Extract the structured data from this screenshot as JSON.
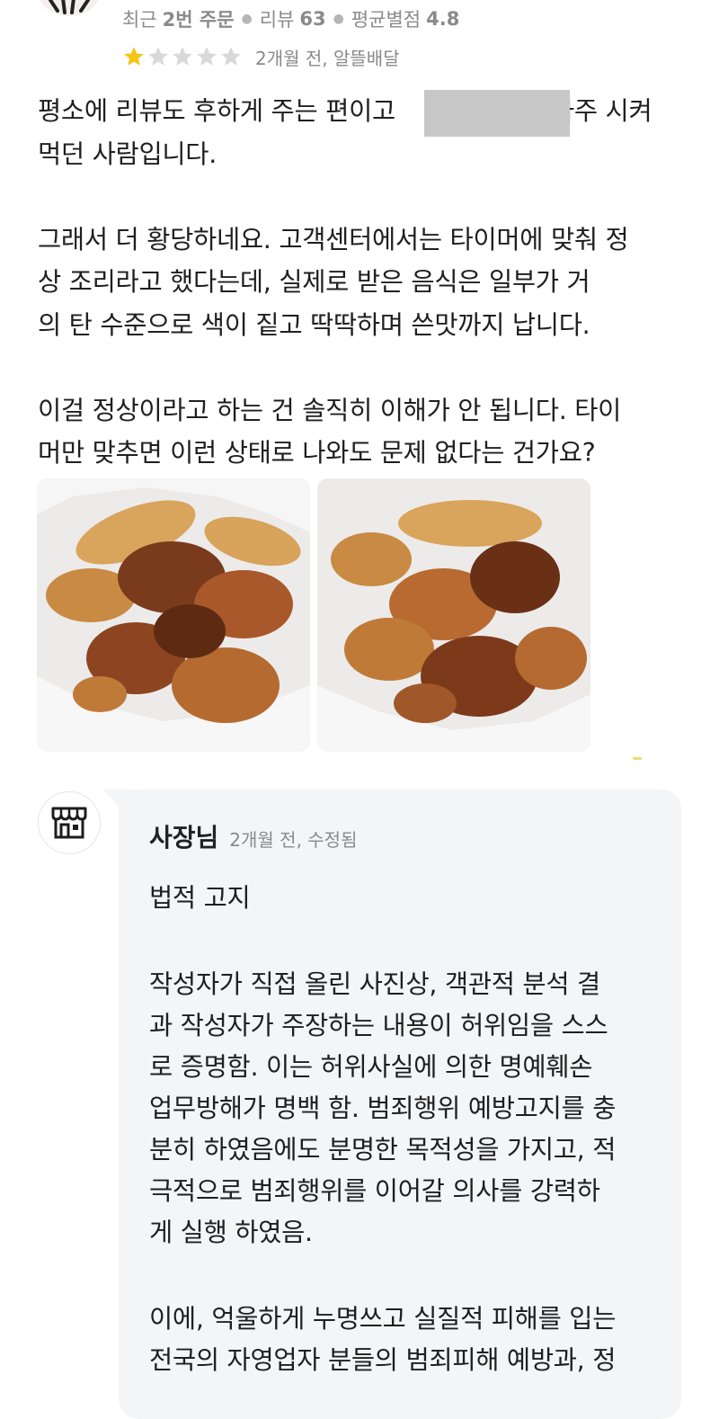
{
  "reviewer": {
    "meta_prefix": "최근",
    "orders": "2번 주문",
    "reviews_label": "리뷰",
    "reviews_count": "63",
    "avg_label": "평균별점",
    "avg_value": "4.8"
  },
  "rating": {
    "value": 1,
    "max": 5,
    "filled_color": "#f5c518",
    "empty_color": "#d9d9d9"
  },
  "review_date_source": "2개월 전, 알뜰배달",
  "review_lines": {
    "l1a": "평소에 리뷰도 후하게 주는 편이고",
    "l1b": "자주 시켜",
    "l2": "먹던 사람입니다.",
    "l3": "그래서 더 황당하네요. 고객센터에서는 타이머에 맞춰 정",
    "l4": "상 조리라고 했다는데, 실제로 받은 음식은 일부가 거",
    "l5": "의 탄 수준으로 색이 짙고 딱딱하며 쓴맛까지 납니다.",
    "l6": "이걸 정상이라고 하는 건 솔직히 이해가 안 됩니다. 타이",
    "l7": "머만 맞추면 이런 상태로 나와도 문제 없다는 건가요?"
  },
  "photos": [
    {
      "name": "fried-food-photo-1"
    },
    {
      "name": "fried-food-photo-2"
    }
  ],
  "owner": {
    "name": "사장님",
    "date": "2개월 전, 수정됨",
    "icon": "store-icon"
  },
  "reply_lines": {
    "r1": "법적 고지",
    "r2": "작성자가 직접 올린 사진상, 객관적 분석 결",
    "r3": "과 작성자가 주장하는 내용이 허위임을 스스",
    "r4": "로 증명함. 이는 허위사실에 의한 명예훼손",
    "r5": "업무방해가 명백 함. 범죄행위 예방고지를 충",
    "r6": "분히 하였음에도 분명한 목적성을 가지고, 적",
    "r7": "극적으로 범죄행위를 이어갈 의사를 강력하",
    "r8": "게 실행 하였음.",
    "r9": "이에, 억울하게 누명쓰고 실질적 피해를 입는",
    "r10": "전국의 자영업자 분들의 범죄피해 예방과, 정"
  }
}
